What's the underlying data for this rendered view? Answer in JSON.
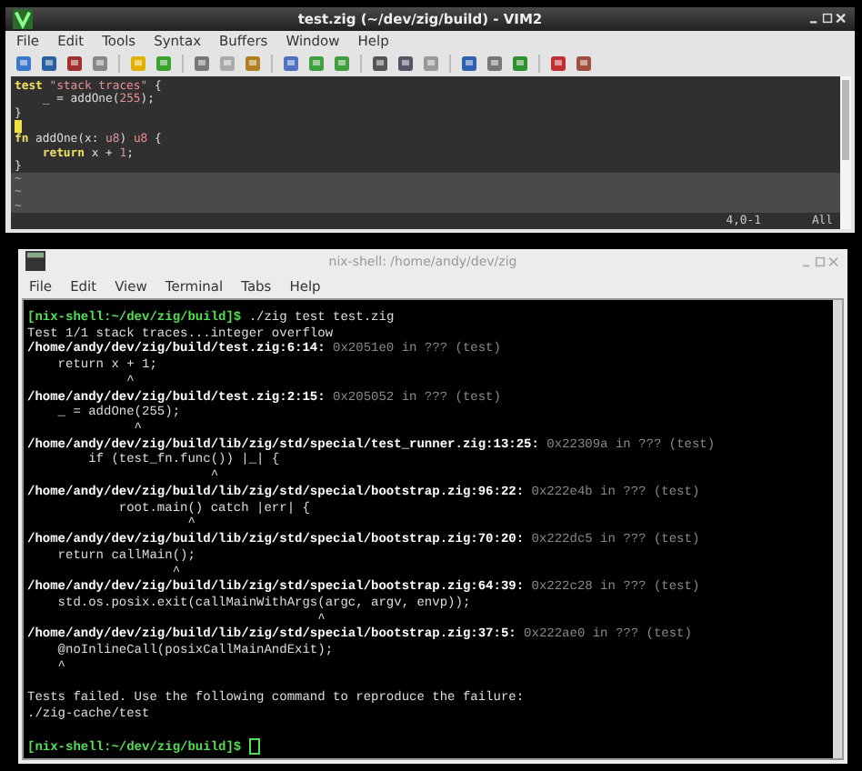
{
  "vim": {
    "title": "test.zig (~/dev/zig/build) - VIM2",
    "menu": [
      "File",
      "Edit",
      "Tools",
      "Syntax",
      "Buffers",
      "Window",
      "Help"
    ],
    "lines": [
      {
        "kind": "code",
        "tokens": [
          {
            "text": "test",
            "kind": "keyword"
          },
          {
            "text": " \"stack traces\"",
            "kind": "string"
          },
          {
            "text": " {",
            "kind": "plain"
          }
        ]
      },
      {
        "kind": "code",
        "tokens": [
          {
            "text": "    _ = addOne(",
            "kind": "plain"
          },
          {
            "text": "255",
            "kind": "number"
          },
          {
            "text": ");",
            "kind": "plain"
          }
        ]
      },
      {
        "kind": "code",
        "tokens": [
          {
            "text": "}",
            "kind": "plain"
          }
        ]
      },
      {
        "kind": "cursor"
      },
      {
        "kind": "code",
        "tokens": [
          {
            "text": "fn",
            "kind": "keyword"
          },
          {
            "text": " addOne(x: ",
            "kind": "plain"
          },
          {
            "text": "u8",
            "kind": "type"
          },
          {
            "text": ") ",
            "kind": "plain"
          },
          {
            "text": "u8",
            "kind": "type"
          },
          {
            "text": " {",
            "kind": "plain"
          }
        ]
      },
      {
        "kind": "code",
        "tokens": [
          {
            "text": "    return",
            "kind": "keyword"
          },
          {
            "text": " x + ",
            "kind": "plain"
          },
          {
            "text": "1",
            "kind": "number"
          },
          {
            "text": ";",
            "kind": "plain"
          }
        ]
      },
      {
        "kind": "code",
        "tokens": [
          {
            "text": "}",
            "kind": "plain"
          }
        ]
      },
      {
        "kind": "filler",
        "tokens": [
          {
            "text": "~",
            "kind": "filler"
          }
        ]
      },
      {
        "kind": "filler",
        "tokens": [
          {
            "text": "~",
            "kind": "filler"
          }
        ]
      },
      {
        "kind": "filler",
        "tokens": [
          {
            "text": "~",
            "kind": "filler"
          }
        ]
      }
    ],
    "position": "4,0-1",
    "scroll": "All"
  },
  "terminal": {
    "title": "nix-shell: /home/andy/dev/zig",
    "menu": [
      "File",
      "Edit",
      "View",
      "Terminal",
      "Tabs",
      "Help"
    ],
    "lines": [
      {
        "kind": "text",
        "segments": [
          {
            "text": "[nix-shell:~/dev/zig/build]$",
            "kind": "prompt"
          },
          {
            "text": " ./zig test test.zig",
            "kind": "plain"
          }
        ]
      },
      {
        "kind": "text",
        "segments": [
          {
            "text": "Test 1/1 stack traces...integer overflow",
            "kind": "plain"
          }
        ]
      },
      {
        "kind": "text",
        "segments": [
          {
            "text": "/home/andy/dev/zig/build/test.zig:6:14:",
            "kind": "path"
          },
          {
            "text": " 0x2051e0 in ??? (test)",
            "kind": "address"
          }
        ]
      },
      {
        "kind": "text",
        "segments": [
          {
            "text": "    return x + 1;",
            "kind": "plain"
          }
        ]
      },
      {
        "kind": "text",
        "segments": [
          {
            "text": "             ^",
            "kind": "plain"
          }
        ]
      },
      {
        "kind": "text",
        "segments": [
          {
            "text": "/home/andy/dev/zig/build/test.zig:2:15:",
            "kind": "path"
          },
          {
            "text": " 0x205052 in ??? (test)",
            "kind": "address"
          }
        ]
      },
      {
        "kind": "text",
        "segments": [
          {
            "text": "    _ = addOne(255);",
            "kind": "plain"
          }
        ]
      },
      {
        "kind": "text",
        "segments": [
          {
            "text": "              ^",
            "kind": "plain"
          }
        ]
      },
      {
        "kind": "text",
        "segments": [
          {
            "text": "/home/andy/dev/zig/build/lib/zig/std/special/test_runner.zig:13:25:",
            "kind": "path"
          },
          {
            "text": " 0x22309a in ??? (test)",
            "kind": "address"
          }
        ]
      },
      {
        "kind": "text",
        "segments": [
          {
            "text": "        if (test_fn.func()) |_| {",
            "kind": "plain"
          }
        ]
      },
      {
        "kind": "text",
        "segments": [
          {
            "text": "                        ^",
            "kind": "plain"
          }
        ]
      },
      {
        "kind": "text",
        "segments": [
          {
            "text": "/home/andy/dev/zig/build/lib/zig/std/special/bootstrap.zig:96:22:",
            "kind": "path"
          },
          {
            "text": " 0x222e4b in ??? (test)",
            "kind": "address"
          }
        ]
      },
      {
        "kind": "text",
        "segments": [
          {
            "text": "            root.main() catch |err| {",
            "kind": "plain"
          }
        ]
      },
      {
        "kind": "text",
        "segments": [
          {
            "text": "                     ^",
            "kind": "plain"
          }
        ]
      },
      {
        "kind": "text",
        "segments": [
          {
            "text": "/home/andy/dev/zig/build/lib/zig/std/special/bootstrap.zig:70:20:",
            "kind": "path"
          },
          {
            "text": " 0x222dc5 in ??? (test)",
            "kind": "address"
          }
        ]
      },
      {
        "kind": "text",
        "segments": [
          {
            "text": "    return callMain();",
            "kind": "plain"
          }
        ]
      },
      {
        "kind": "text",
        "segments": [
          {
            "text": "                   ^",
            "kind": "plain"
          }
        ]
      },
      {
        "kind": "text",
        "segments": [
          {
            "text": "/home/andy/dev/zig/build/lib/zig/std/special/bootstrap.zig:64:39:",
            "kind": "path"
          },
          {
            "text": " 0x222c28 in ??? (test)",
            "kind": "address"
          }
        ]
      },
      {
        "kind": "text",
        "segments": [
          {
            "text": "    std.os.posix.exit(callMainWithArgs(argc, argv, envp));",
            "kind": "plain"
          }
        ]
      },
      {
        "kind": "text",
        "segments": [
          {
            "text": "                                      ^",
            "kind": "plain"
          }
        ]
      },
      {
        "kind": "text",
        "segments": [
          {
            "text": "/home/andy/dev/zig/build/lib/zig/std/special/bootstrap.zig:37:5:",
            "kind": "path"
          },
          {
            "text": " 0x222ae0 in ??? (test)",
            "kind": "address"
          }
        ]
      },
      {
        "kind": "text",
        "segments": [
          {
            "text": "    @noInlineCall(posixCallMainAndExit);",
            "kind": "plain"
          }
        ]
      },
      {
        "kind": "text",
        "segments": [
          {
            "text": "    ^",
            "kind": "plain"
          }
        ]
      },
      {
        "kind": "blank"
      },
      {
        "kind": "text",
        "segments": [
          {
            "text": "Tests failed. Use the following command to reproduce the failure:",
            "kind": "plain"
          }
        ]
      },
      {
        "kind": "text",
        "segments": [
          {
            "text": "./zig-cache/test",
            "kind": "plain"
          }
        ]
      },
      {
        "kind": "blank"
      },
      {
        "kind": "text",
        "segments": [
          {
            "text": "[nix-shell:~/dev/zig/build]$",
            "kind": "prompt"
          }
        ],
        "cursor": true
      }
    ]
  }
}
